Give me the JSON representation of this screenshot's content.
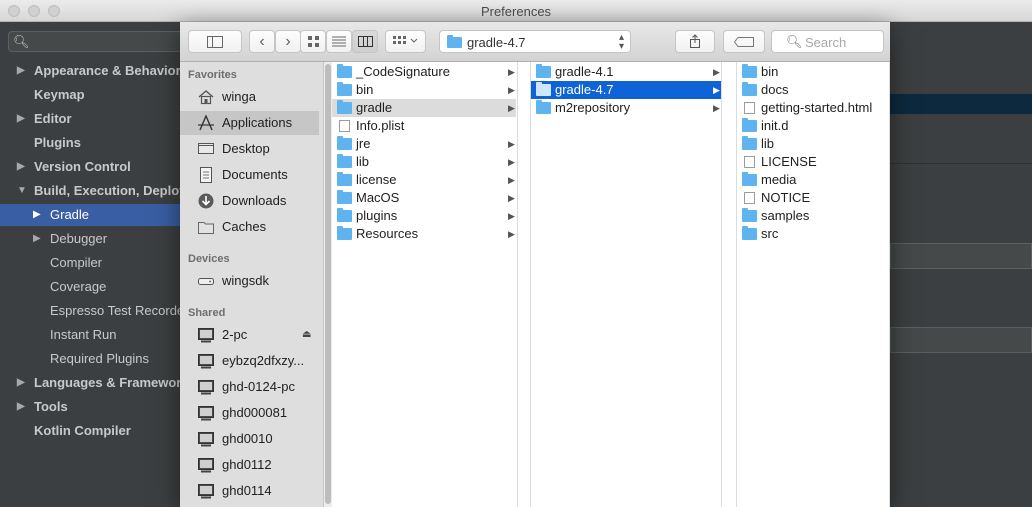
{
  "window": {
    "title": "Preferences"
  },
  "ide": {
    "search_icon": "search-icon",
    "tree": [
      {
        "label": "Appearance & Behavior",
        "arrow": "▶",
        "level": 0,
        "bold": true
      },
      {
        "label": "Keymap",
        "arrow": "",
        "level": 0,
        "bold": true
      },
      {
        "label": "Editor",
        "arrow": "▶",
        "level": 0,
        "bold": true
      },
      {
        "label": "Plugins",
        "arrow": "",
        "level": 0,
        "bold": true
      },
      {
        "label": "Version Control",
        "arrow": "▶",
        "level": 0,
        "bold": true
      },
      {
        "label": "Build, Execution, Deployment",
        "arrow": "▼",
        "level": 0,
        "bold": true
      },
      {
        "label": "Gradle",
        "arrow": "▶",
        "level": 1,
        "bold": false,
        "selected": true
      },
      {
        "label": "Debugger",
        "arrow": "▶",
        "level": 1,
        "bold": false
      },
      {
        "label": "Compiler",
        "arrow": "",
        "level": 1,
        "bold": false
      },
      {
        "label": "Coverage",
        "arrow": "",
        "level": 1,
        "bold": false
      },
      {
        "label": "Espresso Test Recorder",
        "arrow": "",
        "level": 1,
        "bold": false
      },
      {
        "label": "Instant Run",
        "arrow": "",
        "level": 1,
        "bold": false
      },
      {
        "label": "Required Plugins",
        "arrow": "",
        "level": 1,
        "bold": false
      },
      {
        "label": "Languages & Frameworks",
        "arrow": "▶",
        "level": 0,
        "bold": true
      },
      {
        "label": "Tools",
        "arrow": "▶",
        "level": 0,
        "bold": true
      },
      {
        "label": "Kotlin Compiler",
        "arrow": "",
        "level": 0,
        "bold": true
      }
    ]
  },
  "finder": {
    "toolbar": {
      "sidebar_toggle": "sidebar-toggle-icon",
      "back": "‹",
      "forward": "›",
      "view_icons": "icon-view-icon",
      "view_list": "list-view-icon",
      "view_columns": "column-view-icon",
      "arrange": "arrange-icon",
      "path_label": "gradle-4.7",
      "share": "share-icon",
      "tag": "tag-icon",
      "search_placeholder": "Search"
    },
    "sidebar": {
      "favorites_header": "Favorites",
      "favorites": [
        {
          "label": "winga",
          "icon": "home-icon"
        },
        {
          "label": "Applications",
          "icon": "applications-icon",
          "selected": true
        },
        {
          "label": "Desktop",
          "icon": "desktop-icon"
        },
        {
          "label": "Documents",
          "icon": "documents-icon"
        },
        {
          "label": "Downloads",
          "icon": "downloads-icon"
        },
        {
          "label": "Caches",
          "icon": "folder-icon"
        }
      ],
      "devices_header": "Devices",
      "devices": [
        {
          "label": "wingsdk",
          "icon": "disk-icon"
        }
      ],
      "shared_header": "Shared",
      "shared": [
        {
          "label": "2-pc",
          "icon": "computer-icon",
          "eject": "⏏"
        },
        {
          "label": "eybzq2dfxzy...",
          "icon": "computer-icon"
        },
        {
          "label": "ghd-0124-pc",
          "icon": "computer-icon"
        },
        {
          "label": "ghd000081",
          "icon": "computer-icon"
        },
        {
          "label": "ghd0010",
          "icon": "computer-icon"
        },
        {
          "label": "ghd0112",
          "icon": "computer-icon"
        },
        {
          "label": "ghd0114",
          "icon": "computer-icon"
        }
      ]
    },
    "columns": [
      {
        "items": [
          {
            "label": "_CodeSignature",
            "type": "folder",
            "chevron": "▶"
          },
          {
            "label": "bin",
            "type": "folder",
            "chevron": "▶"
          },
          {
            "label": "gradle",
            "type": "folder",
            "chevron": "▶",
            "state": "hl"
          },
          {
            "label": "Info.plist",
            "type": "file",
            "chevron": ""
          },
          {
            "label": "jre",
            "type": "folder",
            "chevron": "▶"
          },
          {
            "label": "lib",
            "type": "folder",
            "chevron": "▶"
          },
          {
            "label": "license",
            "type": "folder",
            "chevron": "▶"
          },
          {
            "label": "MacOS",
            "type": "folder",
            "chevron": "▶"
          },
          {
            "label": "plugins",
            "type": "folder",
            "chevron": "▶"
          },
          {
            "label": "Resources",
            "type": "folder",
            "chevron": "▶"
          }
        ]
      },
      {
        "items": [
          {
            "label": "gradle-4.1",
            "type": "folder",
            "chevron": "▶"
          },
          {
            "label": "gradle-4.7",
            "type": "folder",
            "chevron": "▶",
            "state": "sel"
          },
          {
            "label": "m2repository",
            "type": "folder",
            "chevron": "▶"
          }
        ]
      },
      {
        "items": [
          {
            "label": "bin",
            "type": "folder",
            "chevron": ""
          },
          {
            "label": "docs",
            "type": "folder",
            "chevron": ""
          },
          {
            "label": "getting-started.html",
            "type": "file",
            "chevron": ""
          },
          {
            "label": "init.d",
            "type": "folder",
            "chevron": ""
          },
          {
            "label": "lib",
            "type": "folder",
            "chevron": ""
          },
          {
            "label": "LICENSE",
            "type": "file",
            "chevron": ""
          },
          {
            "label": "media",
            "type": "folder",
            "chevron": ""
          },
          {
            "label": "NOTICE",
            "type": "file",
            "chevron": ""
          },
          {
            "label": "samples",
            "type": "folder",
            "chevron": ""
          },
          {
            "label": "src",
            "type": "folder",
            "chevron": ""
          }
        ]
      }
    ]
  },
  "colors": {
    "ide_bg": "#3c3f41",
    "ide_selection": "#3a5ea3",
    "finder_selection": "#0e63d6",
    "folder_blue": "#5fb4f0"
  }
}
